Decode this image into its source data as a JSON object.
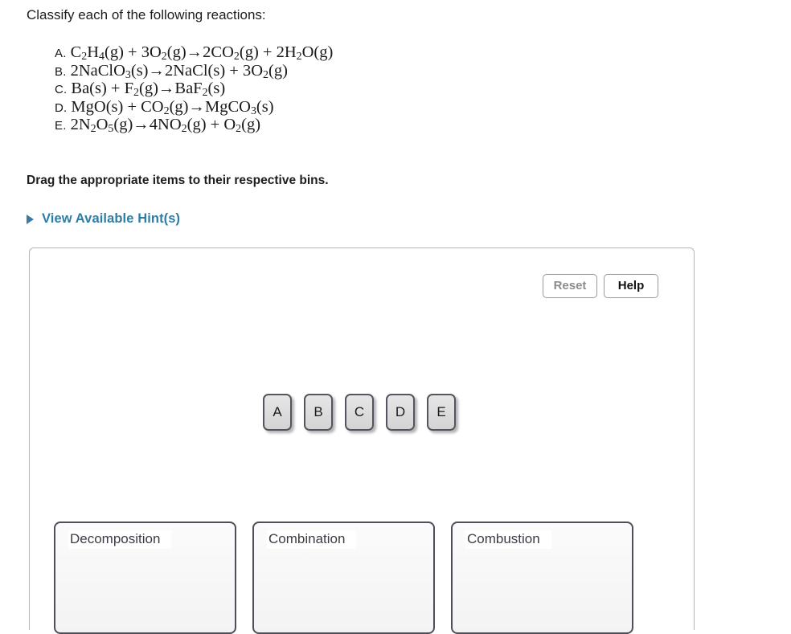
{
  "prompt": "Classify each of the following reactions:",
  "equations": [
    {
      "label": "A.",
      "html": "C<sub>2</sub>H<sub>4</sub>(g) + 3O<sub>2</sub>(g)→2CO<sub>2</sub>(g) + 2H<sub>2</sub>O(g)",
      "plain": "C2H4(g) + 3O2(g)→2CO2(g) + 2H2O(g)"
    },
    {
      "label": "B.",
      "html": "2NaClO<sub>3</sub>(s)→2NaCl(s) + 3O<sub>2</sub>(g)",
      "plain": "2NaClO3(s)→2NaCl(s) + 3O2(g)"
    },
    {
      "label": "C.",
      "html": "Ba(s) + F<sub>2</sub>(g)→BaF<sub>2</sub>(s)",
      "plain": "Ba(s) + F2(g)→BaF2(s)"
    },
    {
      "label": "D.",
      "html": "MgO(s) + CO<sub>2</sub>(g)→MgCO<sub>3</sub>(s)",
      "plain": "MgO(s) + CO2(g)→MgCO3(s)"
    },
    {
      "label": "E.",
      "html": "2N<sub>2</sub>O<sub>5</sub>(g)→4NO<sub>2</sub>(g) + O<sub>2</sub>(g)",
      "plain": "2N2O5(g)→4NO2(g) + O2(g)"
    }
  ],
  "instruction": "Drag the appropriate items to their respective bins.",
  "hint": {
    "label": "View Available Hint(s)",
    "icon": "triangle-right-icon",
    "color": "#2f7ca5",
    "expanded": false
  },
  "toolbar": {
    "reset_label": "Reset",
    "help_label": "Help",
    "reset_color": "#8c8c8c",
    "help_color": "#111111"
  },
  "tiles": [
    {
      "label": "A"
    },
    {
      "label": "B"
    },
    {
      "label": "C"
    },
    {
      "label": "D"
    },
    {
      "label": "E"
    }
  ],
  "bins": [
    {
      "label": "Decomposition",
      "items": []
    },
    {
      "label": "Combination",
      "items": []
    },
    {
      "label": "Combustion",
      "items": []
    }
  ],
  "colors": {
    "panel_border": "#b5b5b5",
    "tile_border": "#55555f",
    "tile_fill": "#e0e0e0",
    "bin_border": "#4e4e5e",
    "bin_fill": "#f5f5f5",
    "link": "#2f7ca5"
  }
}
